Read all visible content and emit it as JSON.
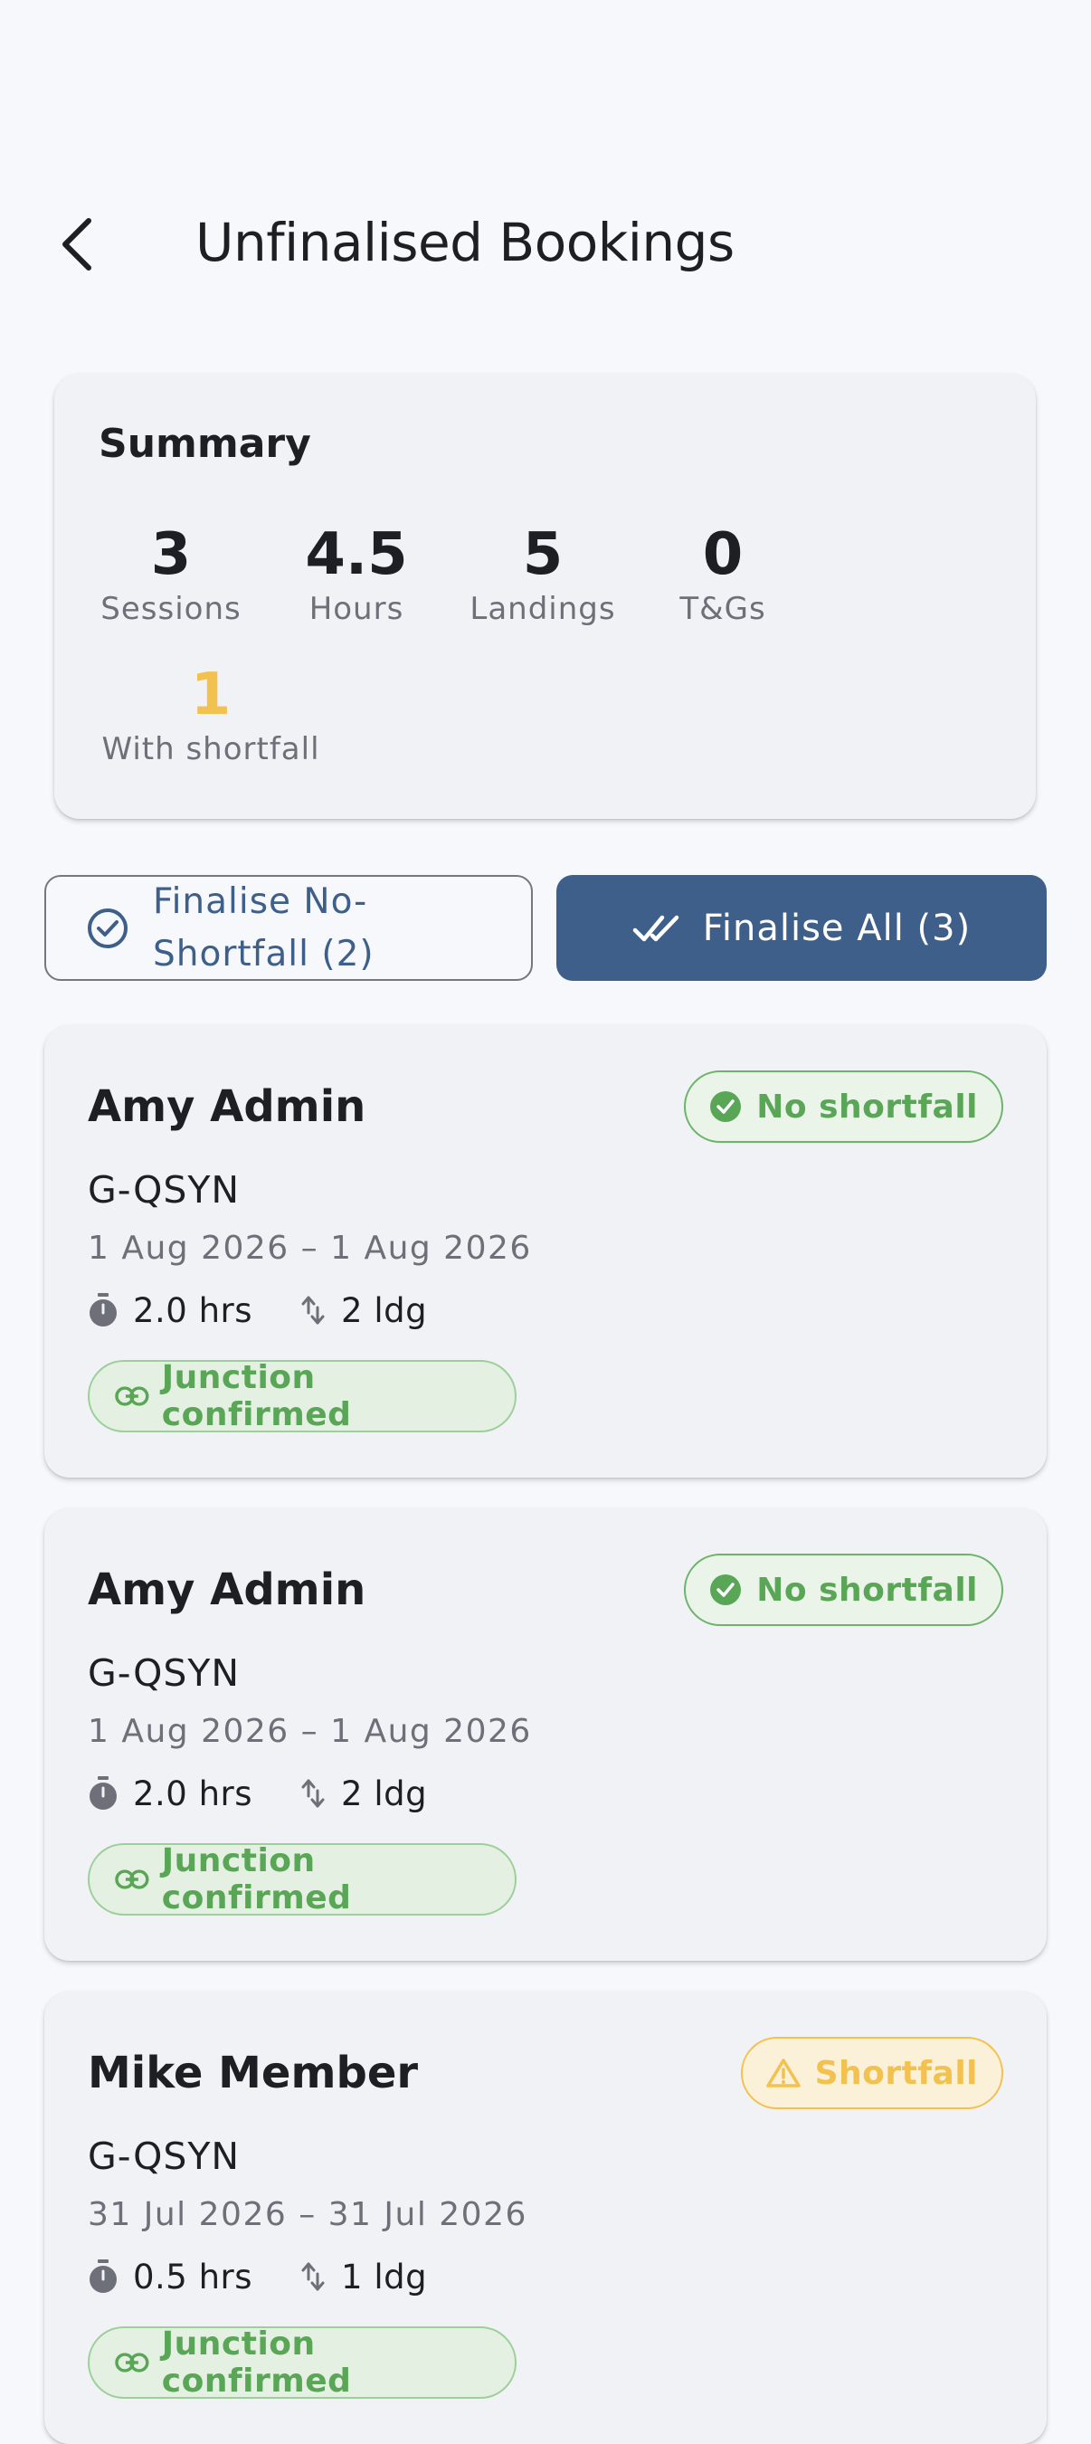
{
  "header": {
    "title": "Unfinalised Bookings",
    "back_icon": "chevron-left-icon"
  },
  "summary": {
    "title": "Summary",
    "stats": [
      {
        "value": "3",
        "label": "Sessions"
      },
      {
        "value": "4.5",
        "label": "Hours"
      },
      {
        "value": "5",
        "label": "Landings"
      },
      {
        "value": "0",
        "label": "T&Gs"
      }
    ],
    "shortfall": {
      "value": "1",
      "label": "With shortfall"
    }
  },
  "actions": {
    "finalise_no_shortfall_line1": "Finalise No-",
    "finalise_no_shortfall_line2": "Shortfall (2)",
    "finalise_all": "Finalise All (3)"
  },
  "bookings": [
    {
      "member": "Amy Admin",
      "status": "No shortfall",
      "aircraft": "G-QSYN",
      "dates": "1 Aug 2026 – 1 Aug 2026",
      "hours": "2.0 hrs",
      "landings": "2 ldg",
      "junction": "Junction confirmed"
    },
    {
      "member": "Amy Admin",
      "status": "No shortfall",
      "aircraft": "G-QSYN",
      "dates": "1 Aug 2026 – 1 Aug 2026",
      "hours": "2.0 hrs",
      "landings": "2 ldg",
      "junction": "Junction confirmed"
    },
    {
      "member": "Mike Member",
      "status": "Shortfall",
      "aircraft": "G-QSYN",
      "dates": "31 Jul 2026 – 31 Jul 2026",
      "hours": "0.5 hrs",
      "landings": "1 ldg",
      "junction": "Junction confirmed"
    }
  ],
  "colors": {
    "primary": "#3d5f8a",
    "success": "#5aa657",
    "warning": "#f2c14e",
    "background": "#f7f8fc",
    "card": "#f1f2f6"
  }
}
